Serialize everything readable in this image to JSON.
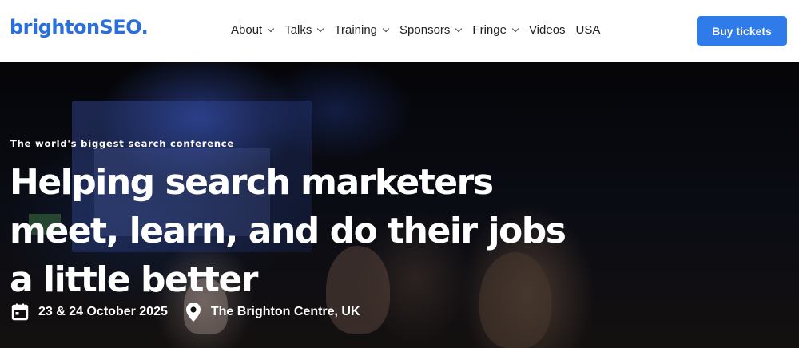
{
  "header": {
    "logo": "brightonSEO.",
    "nav": [
      {
        "label": "About",
        "has_dropdown": true
      },
      {
        "label": "Talks",
        "has_dropdown": true
      },
      {
        "label": "Training",
        "has_dropdown": true
      },
      {
        "label": "Sponsors",
        "has_dropdown": true
      },
      {
        "label": "Fringe",
        "has_dropdown": true
      },
      {
        "label": "Videos",
        "has_dropdown": false
      },
      {
        "label": "USA",
        "has_dropdown": false
      }
    ],
    "buy_button": "Buy tickets"
  },
  "hero": {
    "tagline": "The world's biggest search conference",
    "headline": "Helping search marketers meet, learn, and do their jobs a little better",
    "date": {
      "icon": "calendar-icon",
      "text": "23 & 24 October 2025"
    },
    "venue": {
      "icon": "location-pin-icon",
      "text": "The Brighton Centre, UK"
    }
  },
  "colors": {
    "brand": "#2a6fdb",
    "button": "#2f7bea",
    "header_bg": "#ffffff",
    "hero_text": "#ffffff"
  }
}
